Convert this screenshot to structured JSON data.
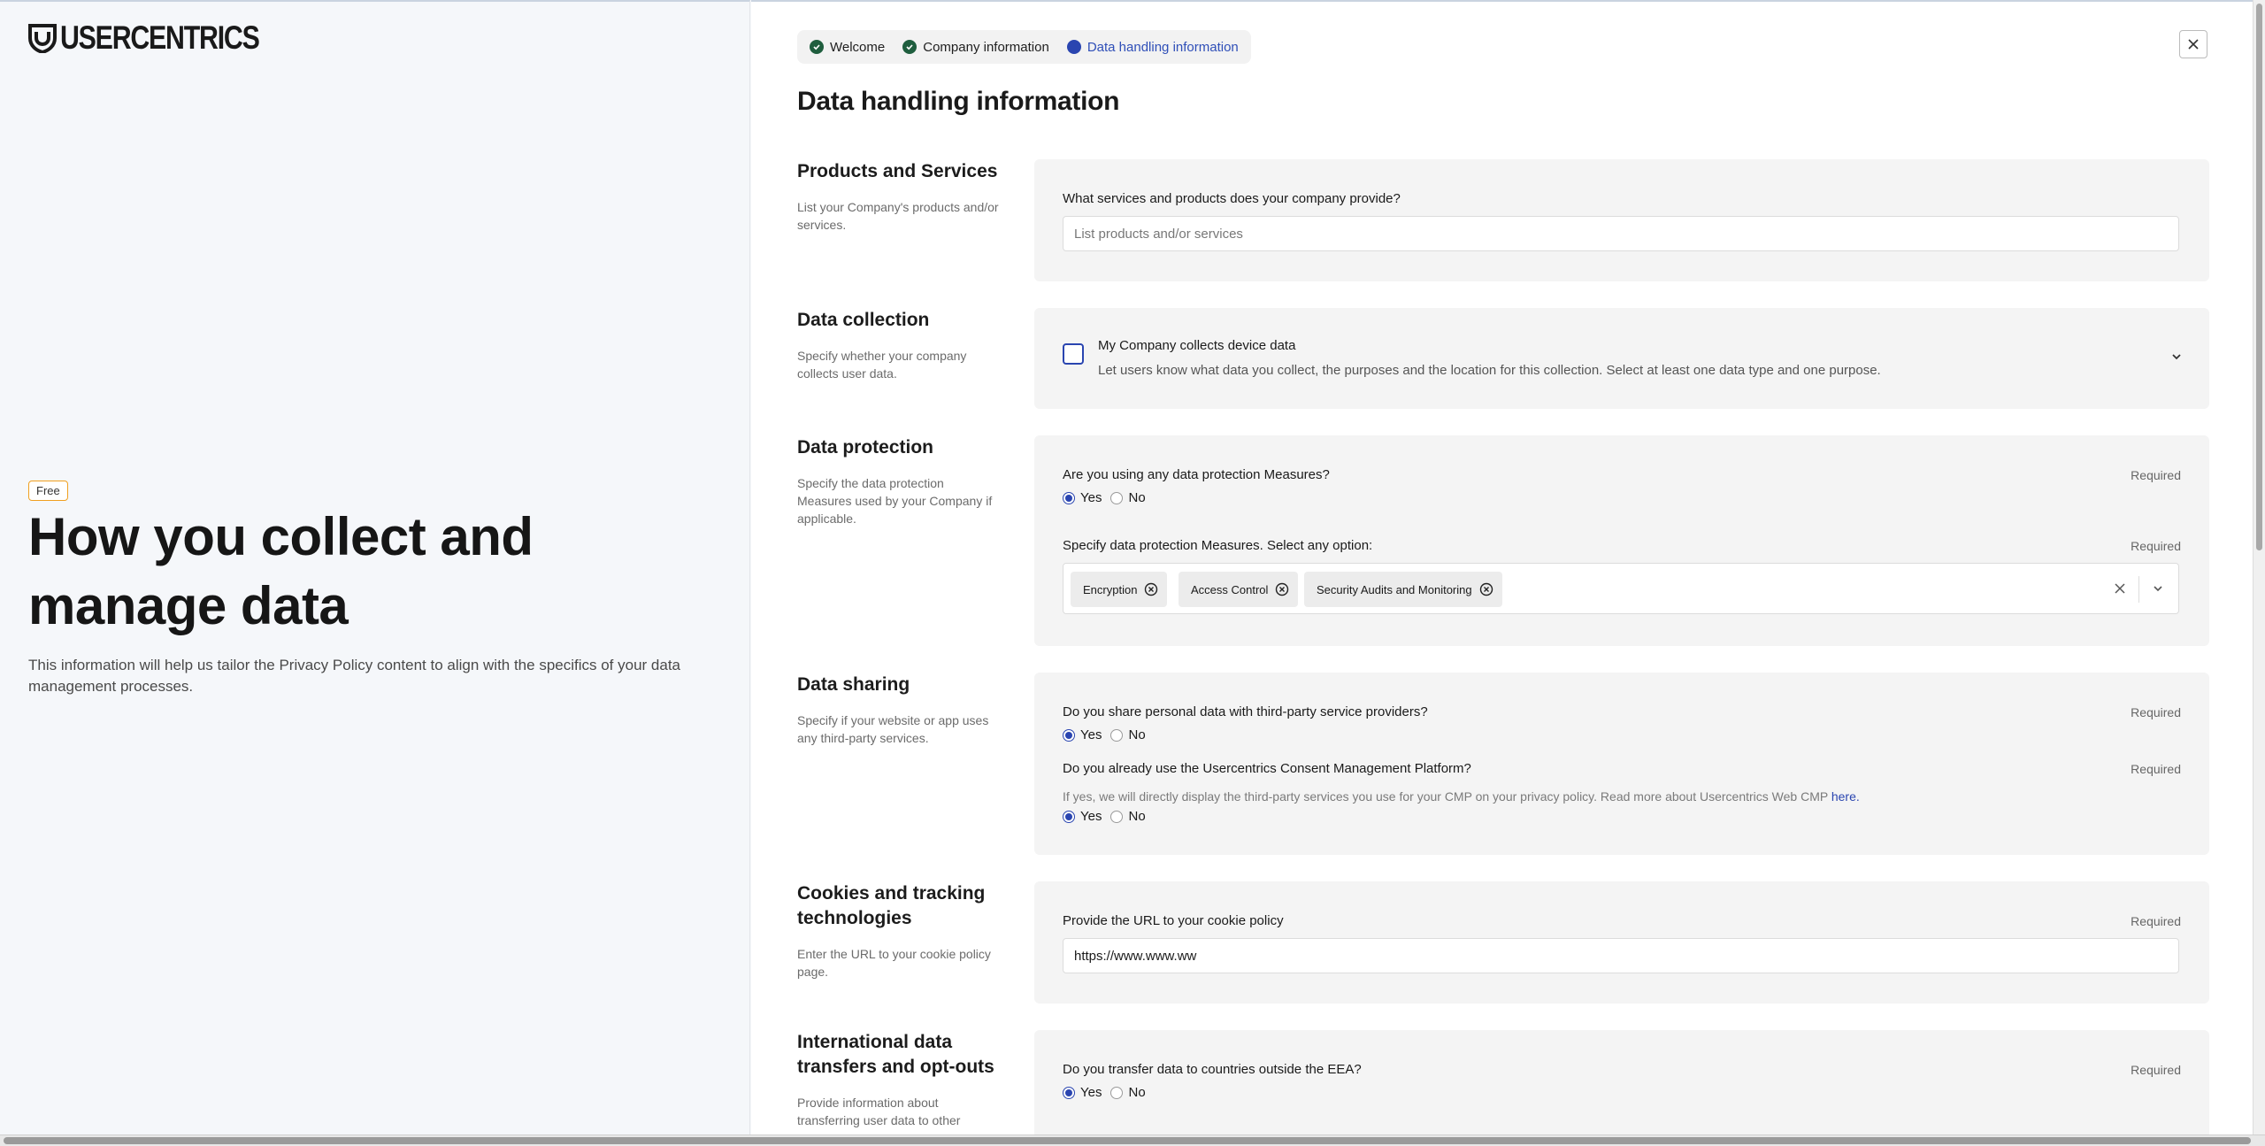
{
  "brand": {
    "name": "USERCENTRICS"
  },
  "hero": {
    "badge": "Free",
    "title": "How you collect and manage data",
    "description": "This information will help us tailor the Privacy Policy content to align with the specifics of your data management processes."
  },
  "stepper": [
    {
      "label": "Welcome",
      "state": "done"
    },
    {
      "label": "Company information",
      "state": "done"
    },
    {
      "label": "Data handling information",
      "state": "active"
    }
  ],
  "page": {
    "title": "Data handling information"
  },
  "required_label": "Required",
  "sections": {
    "products": {
      "title": "Products and Services",
      "desc": "List your Company's products and/or services.",
      "question": "What services and products does your company provide?",
      "placeholder": "List products and/or services",
      "value": ""
    },
    "collection": {
      "title": "Data collection",
      "desc": "Specify whether your company collects user data.",
      "checkbox_label": "My Company collects device data",
      "checkbox_desc": "Let users know what data you collect, the purposes and the location for this collection. Select at least one data type and one purpose.",
      "checked": false
    },
    "protection": {
      "title": "Data protection",
      "desc": "Specify the data protection Measures used by your Company if applicable.",
      "q1": "Are you using any data protection Measures?",
      "q1_yes": "Yes",
      "q1_no": "No",
      "q1_value": "Yes",
      "q2": "Specify data protection Measures. Select any option:",
      "chips": [
        "Encryption",
        "Access Control",
        "Security Audits and Monitoring"
      ]
    },
    "sharing": {
      "title": "Data sharing",
      "desc": "Specify if your website or app uses any third-party services.",
      "q1": "Do you share personal data with third-party service providers?",
      "q1_yes": "Yes",
      "q1_no": "No",
      "q1_value": "Yes",
      "q2": "Do you already use the Usercentrics Consent Management Platform?",
      "q2_hint": "If yes, we will directly display the third-party services you use for your CMP on your privacy policy. Read more about Usercentrics Web CMP",
      "q2_hint_link": "here.",
      "q2_yes": "Yes",
      "q2_no": "No",
      "q2_value": "Yes"
    },
    "cookies": {
      "title": "Cookies and tracking technologies",
      "desc": "Enter the URL to your cookie policy page.",
      "question": "Provide the URL to your cookie policy",
      "value": "https://www.www.ww"
    },
    "international": {
      "title": "International data transfers and opt-outs",
      "desc": "Provide information about transferring user data to other",
      "question": "Do you transfer data to countries outside the EEA?",
      "yes": "Yes",
      "no": "No",
      "value": "Yes"
    }
  },
  "colors": {
    "accent": "#2a45b0",
    "done_green": "#1f5e3e",
    "badge_border": "#f0a020"
  }
}
